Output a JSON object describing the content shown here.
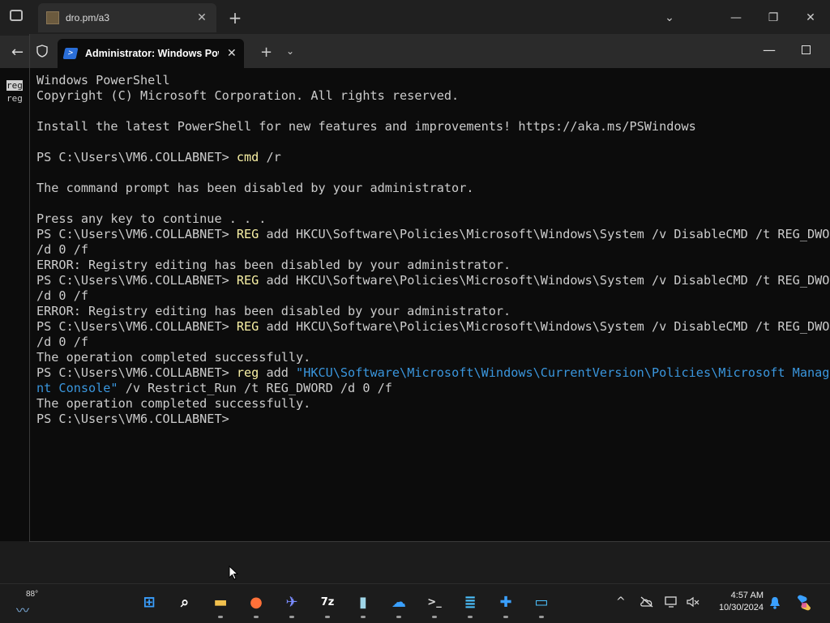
{
  "browser": {
    "tab_title": "dro.pm/a3",
    "tab_close": "✕",
    "new_tab": "+",
    "tab_list": "⌄",
    "minimize": "—",
    "restore": "❐",
    "close": "✕",
    "back": "←",
    "page_lines": [
      "reg",
      "reg"
    ]
  },
  "terminal": {
    "tab_title": "Administrator: Windows PowerShell",
    "tab_close": "✕",
    "new_tab": "+",
    "dropdown": "⌄",
    "minimize": "—",
    "lines": [
      {
        "segments": [
          {
            "t": "Windows PowerShell",
            "c": "out"
          }
        ]
      },
      {
        "segments": [
          {
            "t": "Copyright (C) Microsoft Corporation. All rights reserved.",
            "c": "out"
          }
        ]
      },
      {
        "segments": [
          {
            "t": "",
            "c": "out"
          }
        ]
      },
      {
        "segments": [
          {
            "t": "Install the latest PowerShell for new features and improvements! https://aka.ms/PSWindows",
            "c": "out"
          }
        ]
      },
      {
        "segments": [
          {
            "t": "",
            "c": "out"
          }
        ]
      },
      {
        "segments": [
          {
            "t": "PS C:\\Users\\VM6.COLLABNET> ",
            "c": "out"
          },
          {
            "t": "cmd",
            "c": "cmd"
          },
          {
            "t": " /r",
            "c": "out"
          }
        ]
      },
      {
        "segments": [
          {
            "t": "",
            "c": "out"
          }
        ]
      },
      {
        "segments": [
          {
            "t": "The command prompt has been disabled by your administrator.",
            "c": "out"
          }
        ]
      },
      {
        "segments": [
          {
            "t": "",
            "c": "out"
          }
        ]
      },
      {
        "segments": [
          {
            "t": "Press any key to continue . . .",
            "c": "out"
          }
        ]
      },
      {
        "segments": [
          {
            "t": "PS C:\\Users\\VM6.COLLABNET> ",
            "c": "out"
          },
          {
            "t": "REG",
            "c": "cmd"
          },
          {
            "t": " add HKCU\\Software\\Policies\\Microsoft\\Windows\\System /v DisableCMD /t REG_DWORD",
            "c": "out"
          }
        ]
      },
      {
        "segments": [
          {
            "t": "/d 0 /f",
            "c": "out"
          }
        ]
      },
      {
        "segments": [
          {
            "t": "ERROR: Registry editing has been disabled by your administrator.",
            "c": "out"
          }
        ]
      },
      {
        "segments": [
          {
            "t": "PS C:\\Users\\VM6.COLLABNET> ",
            "c": "out"
          },
          {
            "t": "REG",
            "c": "cmd"
          },
          {
            "t": " add HKCU\\Software\\Policies\\Microsoft\\Windows\\System /v DisableCMD /t REG_DWORD",
            "c": "out"
          }
        ]
      },
      {
        "segments": [
          {
            "t": "/d 0 /f",
            "c": "out"
          }
        ]
      },
      {
        "segments": [
          {
            "t": "ERROR: Registry editing has been disabled by your administrator.",
            "c": "out"
          }
        ]
      },
      {
        "segments": [
          {
            "t": "PS C:\\Users\\VM6.COLLABNET> ",
            "c": "out"
          },
          {
            "t": "REG",
            "c": "cmd"
          },
          {
            "t": " add HKCU\\Software\\Policies\\Microsoft\\Windows\\System /v DisableCMD /t REG_DWORD",
            "c": "out"
          }
        ]
      },
      {
        "segments": [
          {
            "t": "/d 0 /f",
            "c": "out"
          }
        ]
      },
      {
        "segments": [
          {
            "t": "The operation completed successfully.",
            "c": "out"
          }
        ]
      },
      {
        "segments": [
          {
            "t": "PS C:\\Users\\VM6.COLLABNET> ",
            "c": "out"
          },
          {
            "t": "reg",
            "c": "cmd"
          },
          {
            "t": " add ",
            "c": "out"
          },
          {
            "t": "\"HKCU\\Software\\Microsoft\\Windows\\CurrentVersion\\Policies\\Microsoft Managem",
            "c": "str"
          }
        ]
      },
      {
        "segments": [
          {
            "t": "nt Console\"",
            "c": "str"
          },
          {
            "t": " /v Restrict_Run /t REG_DWORD /d 0 /f",
            "c": "out"
          }
        ]
      },
      {
        "segments": [
          {
            "t": "The operation completed successfully.",
            "c": "out"
          }
        ]
      },
      {
        "segments": [
          {
            "t": "PS C:\\Users\\VM6.COLLABNET> ",
            "c": "out"
          }
        ]
      }
    ]
  },
  "taskbar": {
    "weather_temp": "88°",
    "apps": [
      {
        "name": "start-icon",
        "glyph": "⊞",
        "color": "#3aa0ff",
        "running": false
      },
      {
        "name": "search-icon",
        "glyph": "⌕",
        "color": "#ffffff",
        "running": false
      },
      {
        "name": "file-explorer-icon",
        "glyph": "▬",
        "color": "#f2c14e",
        "running": true
      },
      {
        "name": "firefox-icon",
        "glyph": "●",
        "color": "#ff7139",
        "running": true
      },
      {
        "name": "bird-app-icon",
        "glyph": "✈",
        "color": "#7a8cff",
        "running": true
      },
      {
        "name": "7zip-icon",
        "glyph": "7z",
        "color": "#ffffff",
        "running": true
      },
      {
        "name": "notepad-icon",
        "glyph": "▮",
        "color": "#9fd6e8",
        "running": true
      },
      {
        "name": "onedrive-icon",
        "glyph": "☁",
        "color": "#3aa0ff",
        "running": true
      },
      {
        "name": "terminal-icon",
        "glyph": ">_",
        "color": "#dddddd",
        "running": true
      },
      {
        "name": "notes-icon",
        "glyph": "≣",
        "color": "#4cc2ff",
        "running": true
      },
      {
        "name": "puzzle-icon",
        "glyph": "✚",
        "color": "#3aa0ff",
        "running": true
      },
      {
        "name": "remote-desktop-icon",
        "glyph": "▭",
        "color": "#4cc2ff",
        "running": true
      }
    ],
    "tray_chevron": "^",
    "time": "4:57 AM",
    "date": "10/30/2024"
  }
}
